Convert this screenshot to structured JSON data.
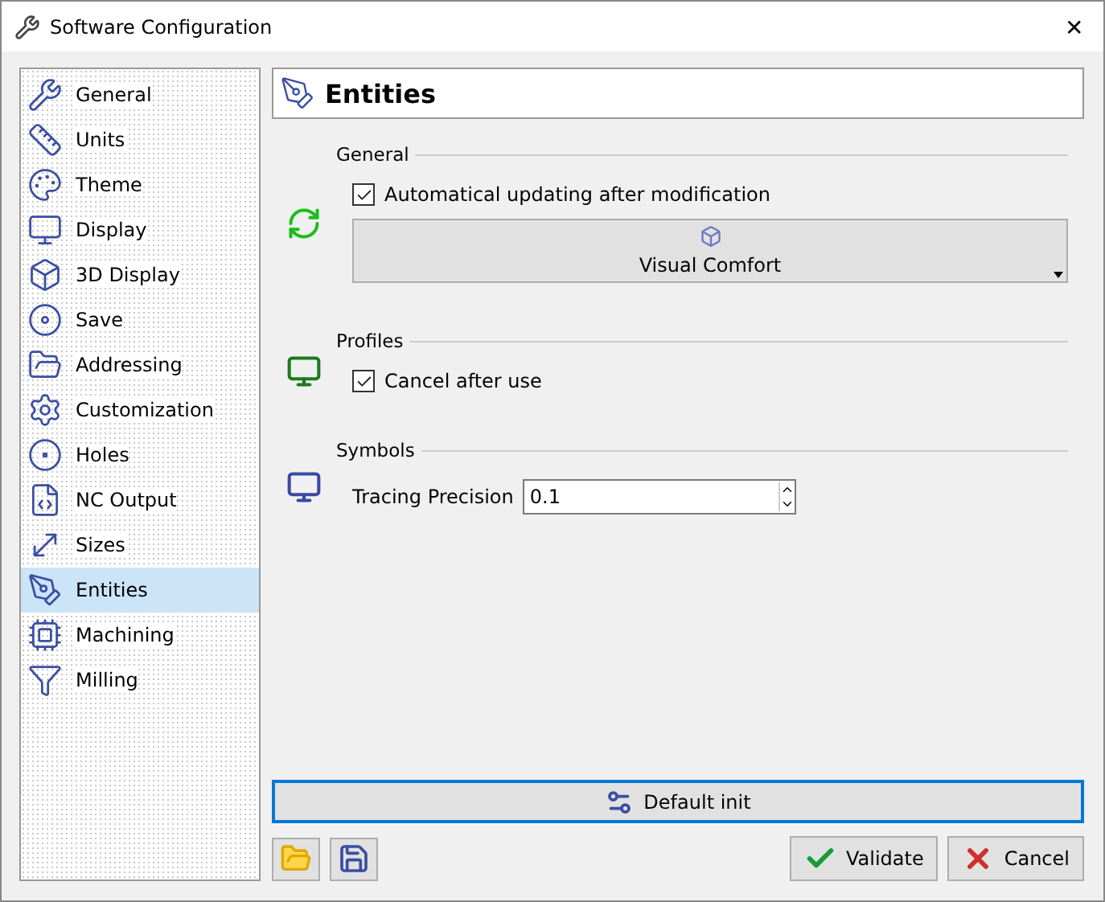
{
  "window": {
    "title": "Software Configuration",
    "close": "✕"
  },
  "sidebar": {
    "items": [
      {
        "label": "General",
        "selected": false
      },
      {
        "label": "Units",
        "selected": false
      },
      {
        "label": "Theme",
        "selected": false
      },
      {
        "label": "Display",
        "selected": false
      },
      {
        "label": "3D Display",
        "selected": false
      },
      {
        "label": "Save",
        "selected": false
      },
      {
        "label": "Addressing",
        "selected": false
      },
      {
        "label": "Customization",
        "selected": false
      },
      {
        "label": "Holes",
        "selected": false
      },
      {
        "label": "NC Output",
        "selected": false
      },
      {
        "label": "Sizes",
        "selected": false
      },
      {
        "label": "Entities",
        "selected": true
      },
      {
        "label": "Machining",
        "selected": false
      },
      {
        "label": "Milling",
        "selected": false
      }
    ]
  },
  "page": {
    "title": "Entities",
    "sections": [
      {
        "title": "General",
        "checkbox": {
          "label": "Automatical updating after modification",
          "checked": true
        },
        "dropdown": {
          "label": "Visual Comfort"
        }
      },
      {
        "title": "Profiles",
        "checkbox": {
          "label": "Cancel after use",
          "checked": true
        }
      },
      {
        "title": "Symbols",
        "spin": {
          "label": "Tracing Precision",
          "value": "0.1"
        }
      }
    ]
  },
  "default_button": "Default init",
  "buttons": [
    "Validate",
    "Cancel"
  ]
}
